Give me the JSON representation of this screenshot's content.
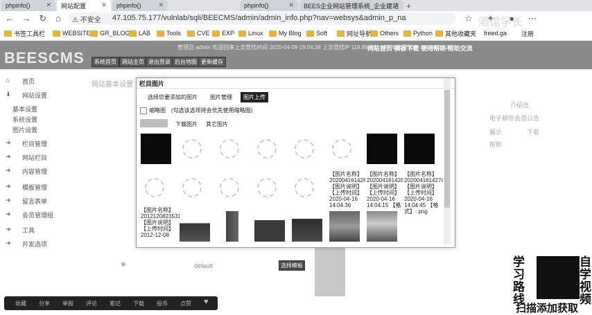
{
  "tabs": [
    {
      "label": "phpinfo()",
      "active": false
    },
    {
      "label": "网站配置",
      "active": true
    },
    {
      "label": "phpinfo()",
      "active": false
    },
    {
      "label": "phpinfo()",
      "active": false
    },
    {
      "label": "BEES企业网站管理系统_企业建站",
      "active": false
    }
  ],
  "address": {
    "security": "不安全",
    "url": "47.105.75.177/vulnlab/sqli/BEECMS/admin/admin_info.php?nav=websys&admin_p_na"
  },
  "bookmarks": [
    "书签工具栏",
    "WEBSITES",
    "GR_BLOG",
    "LAB",
    "Tools",
    "CVE",
    "EXP",
    "Linux",
    "My Blog",
    "Soft",
    "网址导航",
    "Others",
    "Python",
    "其他收藏夹",
    "freed.ga",
    "注册"
  ],
  "admin": {
    "logo": "BEESCMS",
    "topinfo": "管理员 admin 欢迎回来上次登陆时间 2020-04-09 19:04:38 上次登陆IP 119.86.208.180 本次登陆IP 119.86.9.82",
    "toplinks": [
      "网站首页",
      "模板下载",
      "使用帮助",
      "帮助交流"
    ],
    "buttons": [
      "系统首页",
      "网站主页",
      "退出登录",
      "后台地图",
      "更新缓存"
    ]
  },
  "sidebar": [
    "首页",
    "网站设置",
    "基本设置",
    "系统设置",
    "图片设置",
    "栏目管理",
    "网站栏目",
    "内容管理",
    "模板管理",
    "留言表单",
    "会员管理组",
    "工具",
    "开发选项"
  ],
  "background": {
    "heading": "网站基本设置",
    "right_text": [
      "介绍信",
      "电子邮件会员公告",
      "展示",
      "下载",
      "帮助"
    ],
    "row_label": "default",
    "select_btn": "选择模板"
  },
  "dialog": {
    "title": "栏目图片",
    "tabs": [
      "选择您要添加的图片",
      "图片管理",
      "图片上传"
    ],
    "checkbox_label": "缩略图",
    "hint": "(勾选该选项将会优先使用缩略图)",
    "subtabs": [
      "下载图片",
      "其它图片"
    ],
    "captions": [
      {
        "lines": [
          "【图片名称】",
          "20200416142836",
          "【图片说明】",
          "【上传时间】",
          "2020-04-16",
          "14:04:36"
        ]
      },
      {
        "lines": [
          "【图片名称】",
          "20200416142815",
          "【图片说明】",
          "【上传时间】",
          "2020-04-16",
          "14:04:15 【格"
        ]
      },
      {
        "lines": [
          "【图片名称】",
          "20200416142745",
          "【图片说明】",
          "【上传时间】",
          "2020-04-16",
          "14:04:45 【格",
          "式】: png"
        ]
      },
      {
        "lines": [
          "【图片名称】",
          "20121208235310",
          "【图片说明】",
          "【上传时间】",
          "2012-12-08"
        ]
      }
    ]
  },
  "watermark": {
    "left": "学习路线",
    "right": "自学视频",
    "bottom": "扫描添加获取",
    "corner": "酒馆学长"
  },
  "bottombar": [
    "收藏",
    "分享",
    "举报",
    "评论",
    "笔记",
    "下载",
    "投币",
    "点赞"
  ]
}
